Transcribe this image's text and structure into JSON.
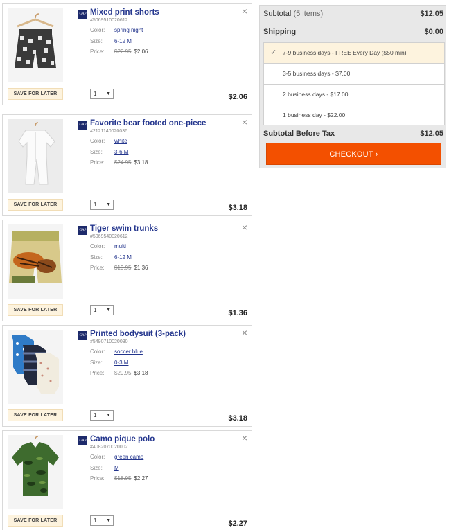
{
  "cart": {
    "save_label": "SAVE FOR LATER",
    "close_glyph": "×",
    "color_label": "Color:",
    "size_label": "Size:",
    "price_label": "Price:",
    "brand_mark": "GAP",
    "qty_arrow": "▼",
    "items": [
      {
        "title": "Mixed print shorts",
        "sku": "#5069510020612",
        "color": "spring night",
        "size": "6-12 M",
        "old_price": "$22.95",
        "price": "$2.06",
        "qty": "1",
        "total": "$2.06"
      },
      {
        "title": "Favorite bear footed one-piece",
        "sku": "#2121140020036",
        "color": "white",
        "size": "3-6 M",
        "old_price": "$24.95",
        "price": "$3.18",
        "qty": "1",
        "total": "$3.18"
      },
      {
        "title": "Tiger swim trunks",
        "sku": "#5069540020612",
        "color": "multi",
        "size": "6-12 M",
        "old_price": "$19.95",
        "price": "$1.36",
        "qty": "1",
        "total": "$1.36"
      },
      {
        "title": "Printed bodysuit (3-pack)",
        "sku": "#5490710020030",
        "color": "soccer blue",
        "size": "0-3 M",
        "old_price": "$29.95",
        "price": "$3.18",
        "qty": "1",
        "total": "$3.18"
      },
      {
        "title": "Camo pique polo",
        "sku": "#4082070020002",
        "color": "green camo",
        "size": "M",
        "old_price": "$18.95",
        "price": "$2.27",
        "qty": "1",
        "total": "$2.27"
      }
    ]
  },
  "summary": {
    "subtotal_label": "Subtotal",
    "subtotal_count": "(5 items)",
    "subtotal_value": "$12.05",
    "shipping_label": "Shipping",
    "shipping_value": "$0.00",
    "options": [
      {
        "label": "7-9 business days - FREE Every Day ($50 min)",
        "selected": true
      },
      {
        "label": "3-5 business days - $7.00",
        "selected": false
      },
      {
        "label": "2 business days - $17.00",
        "selected": false
      },
      {
        "label": "1 business day - $22.00",
        "selected": false
      }
    ],
    "pretax_label": "Subtotal Before Tax",
    "pretax_value": "$12.05",
    "checkout_label": "CHECKOUT ›"
  },
  "colors": {
    "checkout": "#f35000",
    "link": "#23358d",
    "save_bg": "#fdf3de"
  }
}
